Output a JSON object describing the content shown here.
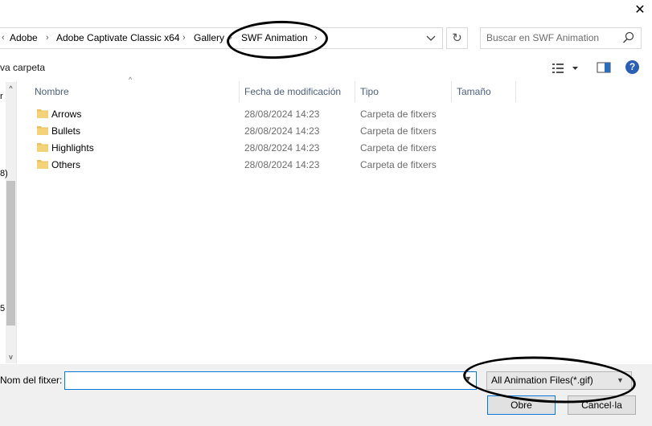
{
  "window": {
    "close_glyph": "✕"
  },
  "address_bar": {
    "breadcrumbs": [
      "Adobe",
      "Adobe Captivate Classic x64",
      "Gallery",
      "SWF Animation"
    ],
    "lead_sep": "‹",
    "sep": "›",
    "dropdown": "⌄"
  },
  "refresh_glyph": "↻",
  "search": {
    "placeholder": "Buscar en SWF Animation"
  },
  "toolbar": {
    "new_folder": "va carpeta",
    "help": "?"
  },
  "nav_fragments": [
    "r",
    "8)",
    "5"
  ],
  "nav_scroll": {
    "up": "^",
    "down": "v"
  },
  "columns": {
    "name": "Nombre",
    "date": "Fecha de modificación",
    "type": "Tipo",
    "size": "Tamaño"
  },
  "sort_glyph": "^",
  "files": [
    {
      "name": "Arrows",
      "date": "28/08/2024 14:23",
      "type": "Carpeta de fitxers"
    },
    {
      "name": "Bullets",
      "date": "28/08/2024 14:23",
      "type": "Carpeta de fitxers"
    },
    {
      "name": "Highlights",
      "date": "28/08/2024 14:23",
      "type": "Carpeta de fitxers"
    },
    {
      "name": "Others",
      "date": "28/08/2024 14:23",
      "type": "Carpeta de fitxers"
    }
  ],
  "footer": {
    "filename_label": "Nom del fitxer:",
    "filename_value": "",
    "filter_value": "All Animation Files(*.gif)",
    "open_label": "Obre",
    "cancel_label": "Cancel·la",
    "dropdown": "▼"
  },
  "colors": {
    "accent": "#0078d7",
    "header_text": "#4c607a",
    "folder": "#e8c160"
  },
  "icons": [
    "close-icon",
    "chevron-down-icon",
    "refresh-icon",
    "search-icon",
    "view-options-icon",
    "preview-pane-icon",
    "help-icon",
    "folder-icon"
  ]
}
